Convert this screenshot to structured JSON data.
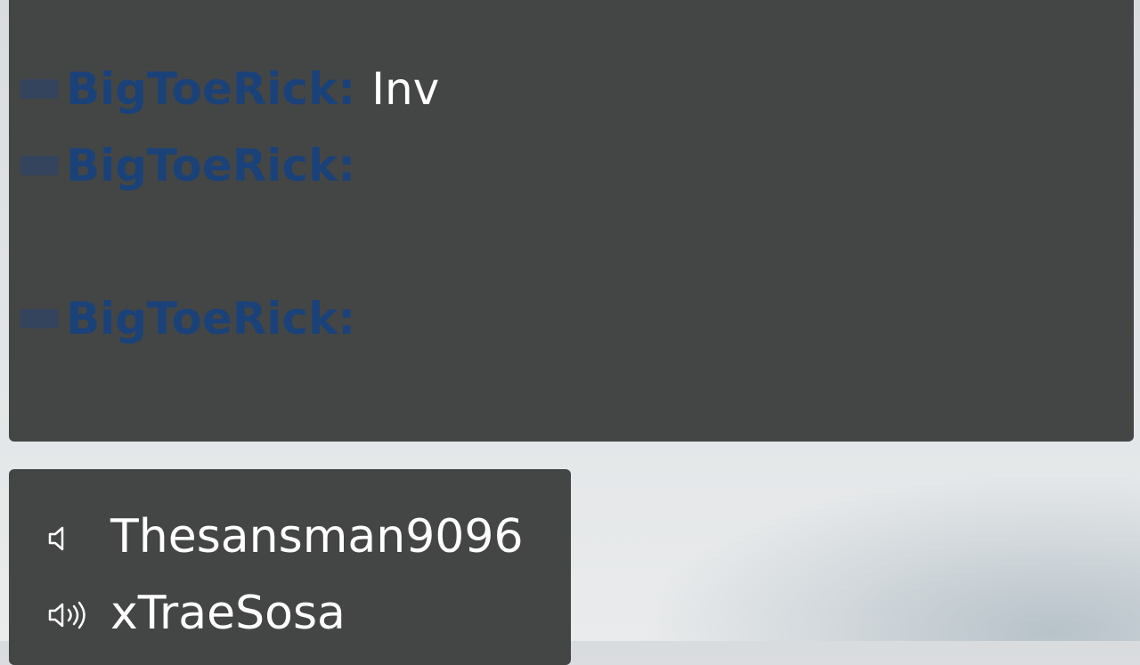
{
  "chat": {
    "messages": [
      {
        "sender": "BigToeRick:",
        "text": "Inv"
      },
      {
        "sender": "BigToeRick:",
        "text": ""
      },
      {
        "sender": "BigToeRick:",
        "text": ""
      }
    ]
  },
  "voice": {
    "members": [
      {
        "name": "Thesansman9096",
        "icon": "speaker-idle-icon"
      },
      {
        "name": "xTraeSosa",
        "icon": "speaker-talking-icon"
      }
    ]
  },
  "colors": {
    "panel_bg": "#444645",
    "sender_name": "#17427e",
    "message_text": "#ffffff"
  }
}
